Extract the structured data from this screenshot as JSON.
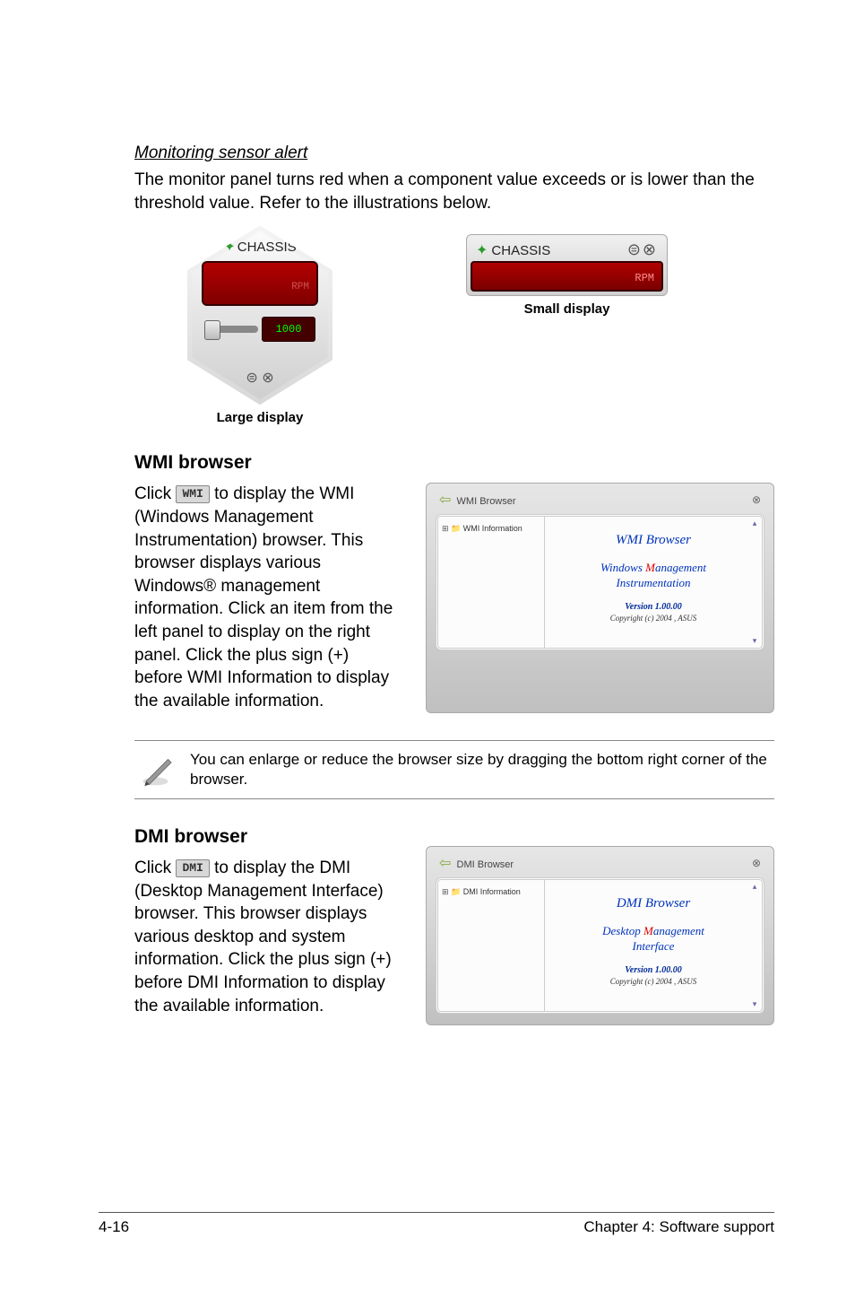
{
  "sensor": {
    "heading": "Monitoring sensor alert",
    "desc": "The monitor panel turns red when a component value exceeds or is lower than the threshold value. Refer to the illustrations below.",
    "chassis_label": "CHASSIS",
    "rpm_label": "RPM",
    "threshold_lcd": "1000",
    "caption_large": "Large display",
    "caption_small": "Small display"
  },
  "wmi": {
    "title": "WMI browser",
    "btn_label": "WMI",
    "body1": "Click ",
    "body2": " to display the WMI (Windows Management Instrumentation) browser. This browser displays various Windows® management information. Click an item from the left panel to display on the right panel. Click the plus sign (+) before WMI Information to display the available information.",
    "window_title": "WMI Browser",
    "tree_item": "WMI Information",
    "content_title": "WMI Browser",
    "content_line1a": "Windows ",
    "content_mword": "M",
    "content_line1b": "anagement",
    "content_line2": "Instrumentation",
    "version": "Version 1.00.00",
    "copyright": "Copyright (c) 2004 , ASUS"
  },
  "note": {
    "text": "You can enlarge or reduce the browser size by dragging the bottom right corner of the browser."
  },
  "dmi": {
    "title": "DMI browser",
    "btn_label": "DMI",
    "body1": "Click ",
    "body2": " to display the DMI (Desktop Management Interface) browser. This browser displays various desktop and system information. Click the plus sign (+) before DMI Information to display the available information.",
    "window_title": "DMI Browser",
    "tree_item": "DMI Information",
    "content_title": "DMI Browser",
    "content_line1a": "Desktop ",
    "content_mword": "M",
    "content_line1b": "anagement",
    "content_line2": "Interface",
    "version": "Version 1.00.00",
    "copyright": "Copyright (c) 2004 , ASUS"
  },
  "footer": {
    "left": "4-16",
    "right": "Chapter 4: Software support"
  }
}
